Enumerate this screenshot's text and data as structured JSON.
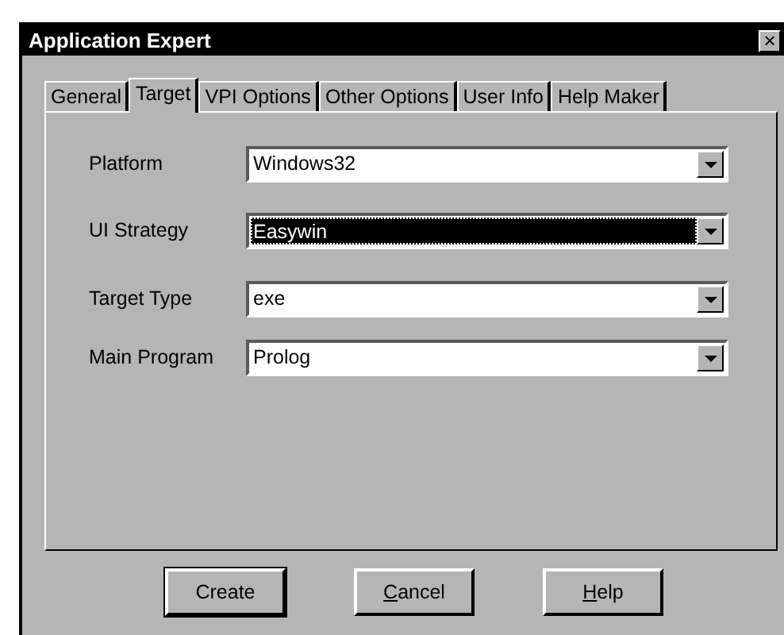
{
  "window": {
    "title": "Application Expert",
    "close": "×"
  },
  "tabs": [
    {
      "label": "General",
      "selected": false
    },
    {
      "label": "Target",
      "selected": true
    },
    {
      "label": "VPI Options",
      "selected": false
    },
    {
      "label": "Other Options",
      "selected": false
    },
    {
      "label": "User Info",
      "selected": false
    },
    {
      "label": "Help Maker",
      "selected": false
    }
  ],
  "fields": [
    {
      "label": "Platform",
      "value": "Windows32",
      "focused": false
    },
    {
      "label": "UI Strategy",
      "value": "Easywin",
      "focused": true
    },
    {
      "label": "Target Type",
      "value": "exe",
      "focused": false
    },
    {
      "label": "Main Program",
      "value": "Prolog",
      "focused": false
    }
  ],
  "buttons": [
    {
      "label": "Create",
      "underline_first": false,
      "default": true
    },
    {
      "label": "Cancel",
      "underline_first": true,
      "default": false
    },
    {
      "label": "Help",
      "underline_first": true,
      "default": false
    }
  ]
}
